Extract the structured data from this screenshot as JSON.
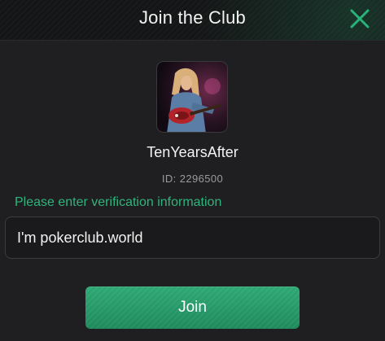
{
  "dialog": {
    "title": "Join the Club",
    "close_icon": "close-icon"
  },
  "profile": {
    "avatar_icon": "avatar",
    "name": "TenYearsAfter",
    "id_text": "ID: 2296500"
  },
  "form": {
    "prompt": "Please enter verification information",
    "message_value": "I'm pokerclub.world",
    "join_label": "Join"
  },
  "colors": {
    "accent": "#2fb57c",
    "button": "#25986a",
    "background": "#1f1f21",
    "header": "#141516"
  }
}
